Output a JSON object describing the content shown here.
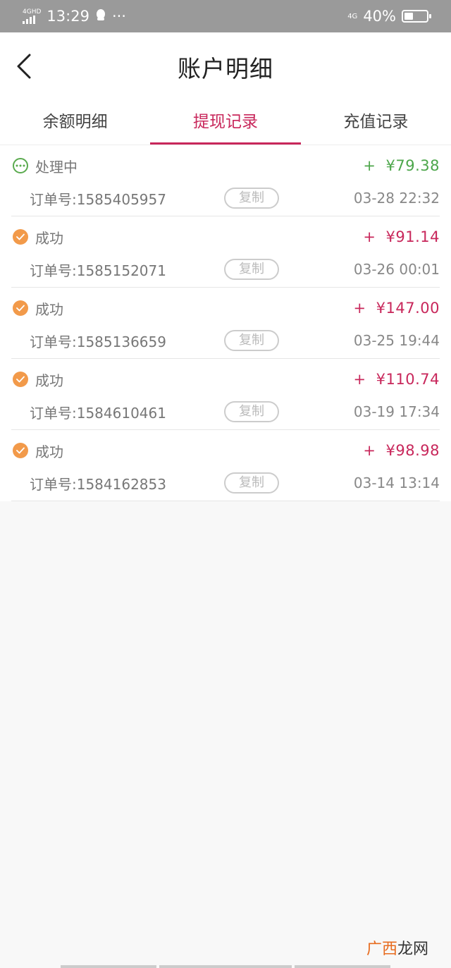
{
  "status_bar": {
    "network": "4GHD",
    "time": "13:29",
    "dots": "···",
    "right_network": "4G",
    "battery": "40%",
    "battery_level": 0.4
  },
  "nav": {
    "title": "账户明细"
  },
  "tabs": [
    {
      "label": "余额明细",
      "active": false
    },
    {
      "label": "提现记录",
      "active": true
    },
    {
      "label": "充值记录",
      "active": false
    }
  ],
  "records": [
    {
      "status": "处理中",
      "status_type": "pending",
      "plus": "+",
      "amount": "¥79.38",
      "order": "订单号:1585405957",
      "copy": "复制",
      "time": "03-28 22:32"
    },
    {
      "status": "成功",
      "status_type": "ok",
      "plus": "+",
      "amount": "¥91.14",
      "order": "订单号:1585152071",
      "copy": "复制",
      "time": "03-26 00:01"
    },
    {
      "status": "成功",
      "status_type": "ok",
      "plus": "+",
      "amount": "¥147.00",
      "order": "订单号:1585136659",
      "copy": "复制",
      "time": "03-25 19:44"
    },
    {
      "status": "成功",
      "status_type": "ok",
      "plus": "+",
      "amount": "¥110.74",
      "order": "订单号:1584610461",
      "copy": "复制",
      "time": "03-19 17:34"
    },
    {
      "status": "成功",
      "status_type": "ok",
      "plus": "+",
      "amount": "¥98.98",
      "order": "订单号:1584162853",
      "copy": "复制",
      "time": "03-14 13:14"
    }
  ],
  "watermark": {
    "part1": "广西",
    "part2": "龙网"
  },
  "colors": {
    "accent": "#c8275b",
    "pending_green": "#4ca64a",
    "success_orange": "#f29a4a"
  }
}
